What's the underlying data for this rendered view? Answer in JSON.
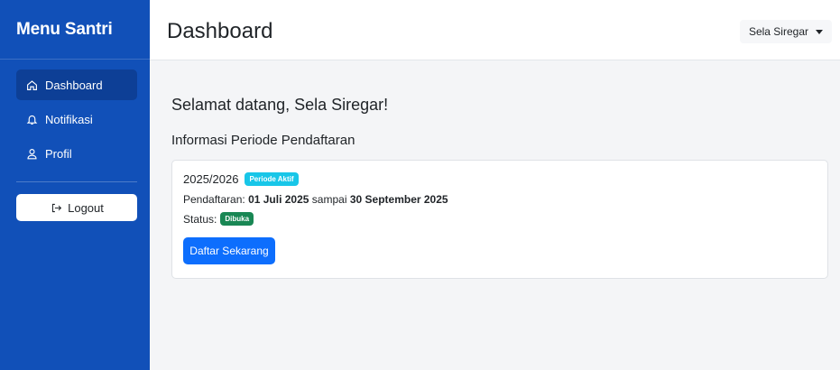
{
  "sidebar": {
    "brand": "Menu Santri",
    "items": [
      {
        "label": "Dashboard",
        "icon": "home-icon",
        "active": true
      },
      {
        "label": "Notifikasi",
        "icon": "bell-icon",
        "active": false
      },
      {
        "label": "Profil",
        "icon": "user-icon",
        "active": false
      }
    ],
    "logout_label": "Logout"
  },
  "header": {
    "title": "Dashboard",
    "user_name": "Sela Siregar"
  },
  "main": {
    "welcome": "Selamat datang, Sela Siregar!",
    "section_title": "Informasi Periode Pendaftaran",
    "period": {
      "year": "2025/2026",
      "badge": "Periode Aktif",
      "registration_prefix": "Pendaftaran:",
      "start_date": "01 Juli 2025",
      "connector": "sampai",
      "end_date": "30 September 2025",
      "status_label": "Status:",
      "status_badge": "Dibuka",
      "cta_label": "Daftar Sekarang"
    }
  },
  "colors": {
    "sidebar_bg": "#1150b8",
    "sidebar_active": "#0d3f96",
    "primary": "#0d6efd",
    "info": "#18c6e8",
    "success": "#198754"
  }
}
